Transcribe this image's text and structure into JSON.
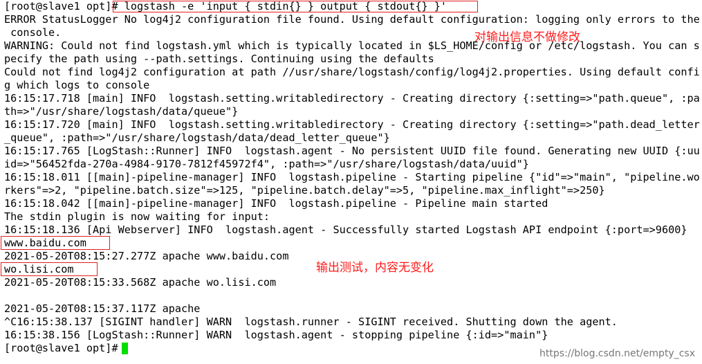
{
  "terminal": {
    "lines": [
      "[root@slave1 opt]# logstash -e 'input { stdin{} } output { stdout{} }'",
      "ERROR StatusLogger No log4j2 configuration file found. Using default configuration: logging only errors to the",
      " console.",
      "WARNING: Could not find logstash.yml which is typically located in $LS_HOME/config or /etc/logstash. You can s",
      "pecify the path using --path.settings. Continuing using the defaults",
      "Could not find log4j2 configuration at path //usr/share/logstash/config/log4j2.properties. Using default confi",
      "g which logs to console",
      "16:15:17.718 [main] INFO  logstash.setting.writabledirectory - Creating directory {:setting=>\"path.queue\", :pa",
      "th=>\"/usr/share/logstash/data/queue\"}",
      "16:15:17.720 [main] INFO  logstash.setting.writabledirectory - Creating directory {:setting=>\"path.dead_letter",
      "_queue\", :path=>\"/usr/share/logstash/data/dead_letter_queue\"}",
      "16:15:17.765 [LogStash::Runner] INFO  logstash.agent - No persistent UUID file found. Generating new UUID {:uu",
      "id=>\"56452fda-270a-4984-9170-7812f45972f4\", :path=>\"/usr/share/logstash/data/uuid\"}",
      "16:15:18.011 [[main]-pipeline-manager] INFO  logstash.pipeline - Starting pipeline {\"id\"=>\"main\", \"pipeline.wo",
      "rkers\"=>2, \"pipeline.batch.size\"=>125, \"pipeline.batch.delay\"=>5, \"pipeline.max_inflight\"=>250}",
      "16:15:18.042 [[main]-pipeline-manager] INFO  logstash.pipeline - Pipeline main started",
      "The stdin plugin is now waiting for input:",
      "16:15:18.136 [Api Webserver] INFO  logstash.agent - Successfully started Logstash API endpoint {:port=>9600}",
      "www.baidu.com",
      "2021-05-20T08:15:27.277Z apache www.baidu.com",
      "wo.lisi.com",
      "2021-05-20T08:15:33.568Z apache wo.lisi.com",
      "",
      "2021-05-20T08:15:37.117Z apache",
      "^C16:15:38.137 [SIGINT handler] WARN  logstash.runner - SIGINT received. Shutting down the agent.",
      "16:15:38.156 [LogStash::Runner] WARN  logstash.agent - stopping pipeline {:id=>\"main\"}",
      "[root@slave1 opt]# "
    ]
  },
  "annotations": {
    "note_top": "对输出信息不做修改",
    "note_mid": "输出测试，内容无变化"
  },
  "watermark": "https://blog.csdn.net/empty_csx",
  "colors": {
    "background": "#ffffff",
    "text": "#000000",
    "annotation": "#ff1a1a",
    "highlight_box": "#e02020",
    "cursor": "#00dd00",
    "watermark": "#777777"
  }
}
